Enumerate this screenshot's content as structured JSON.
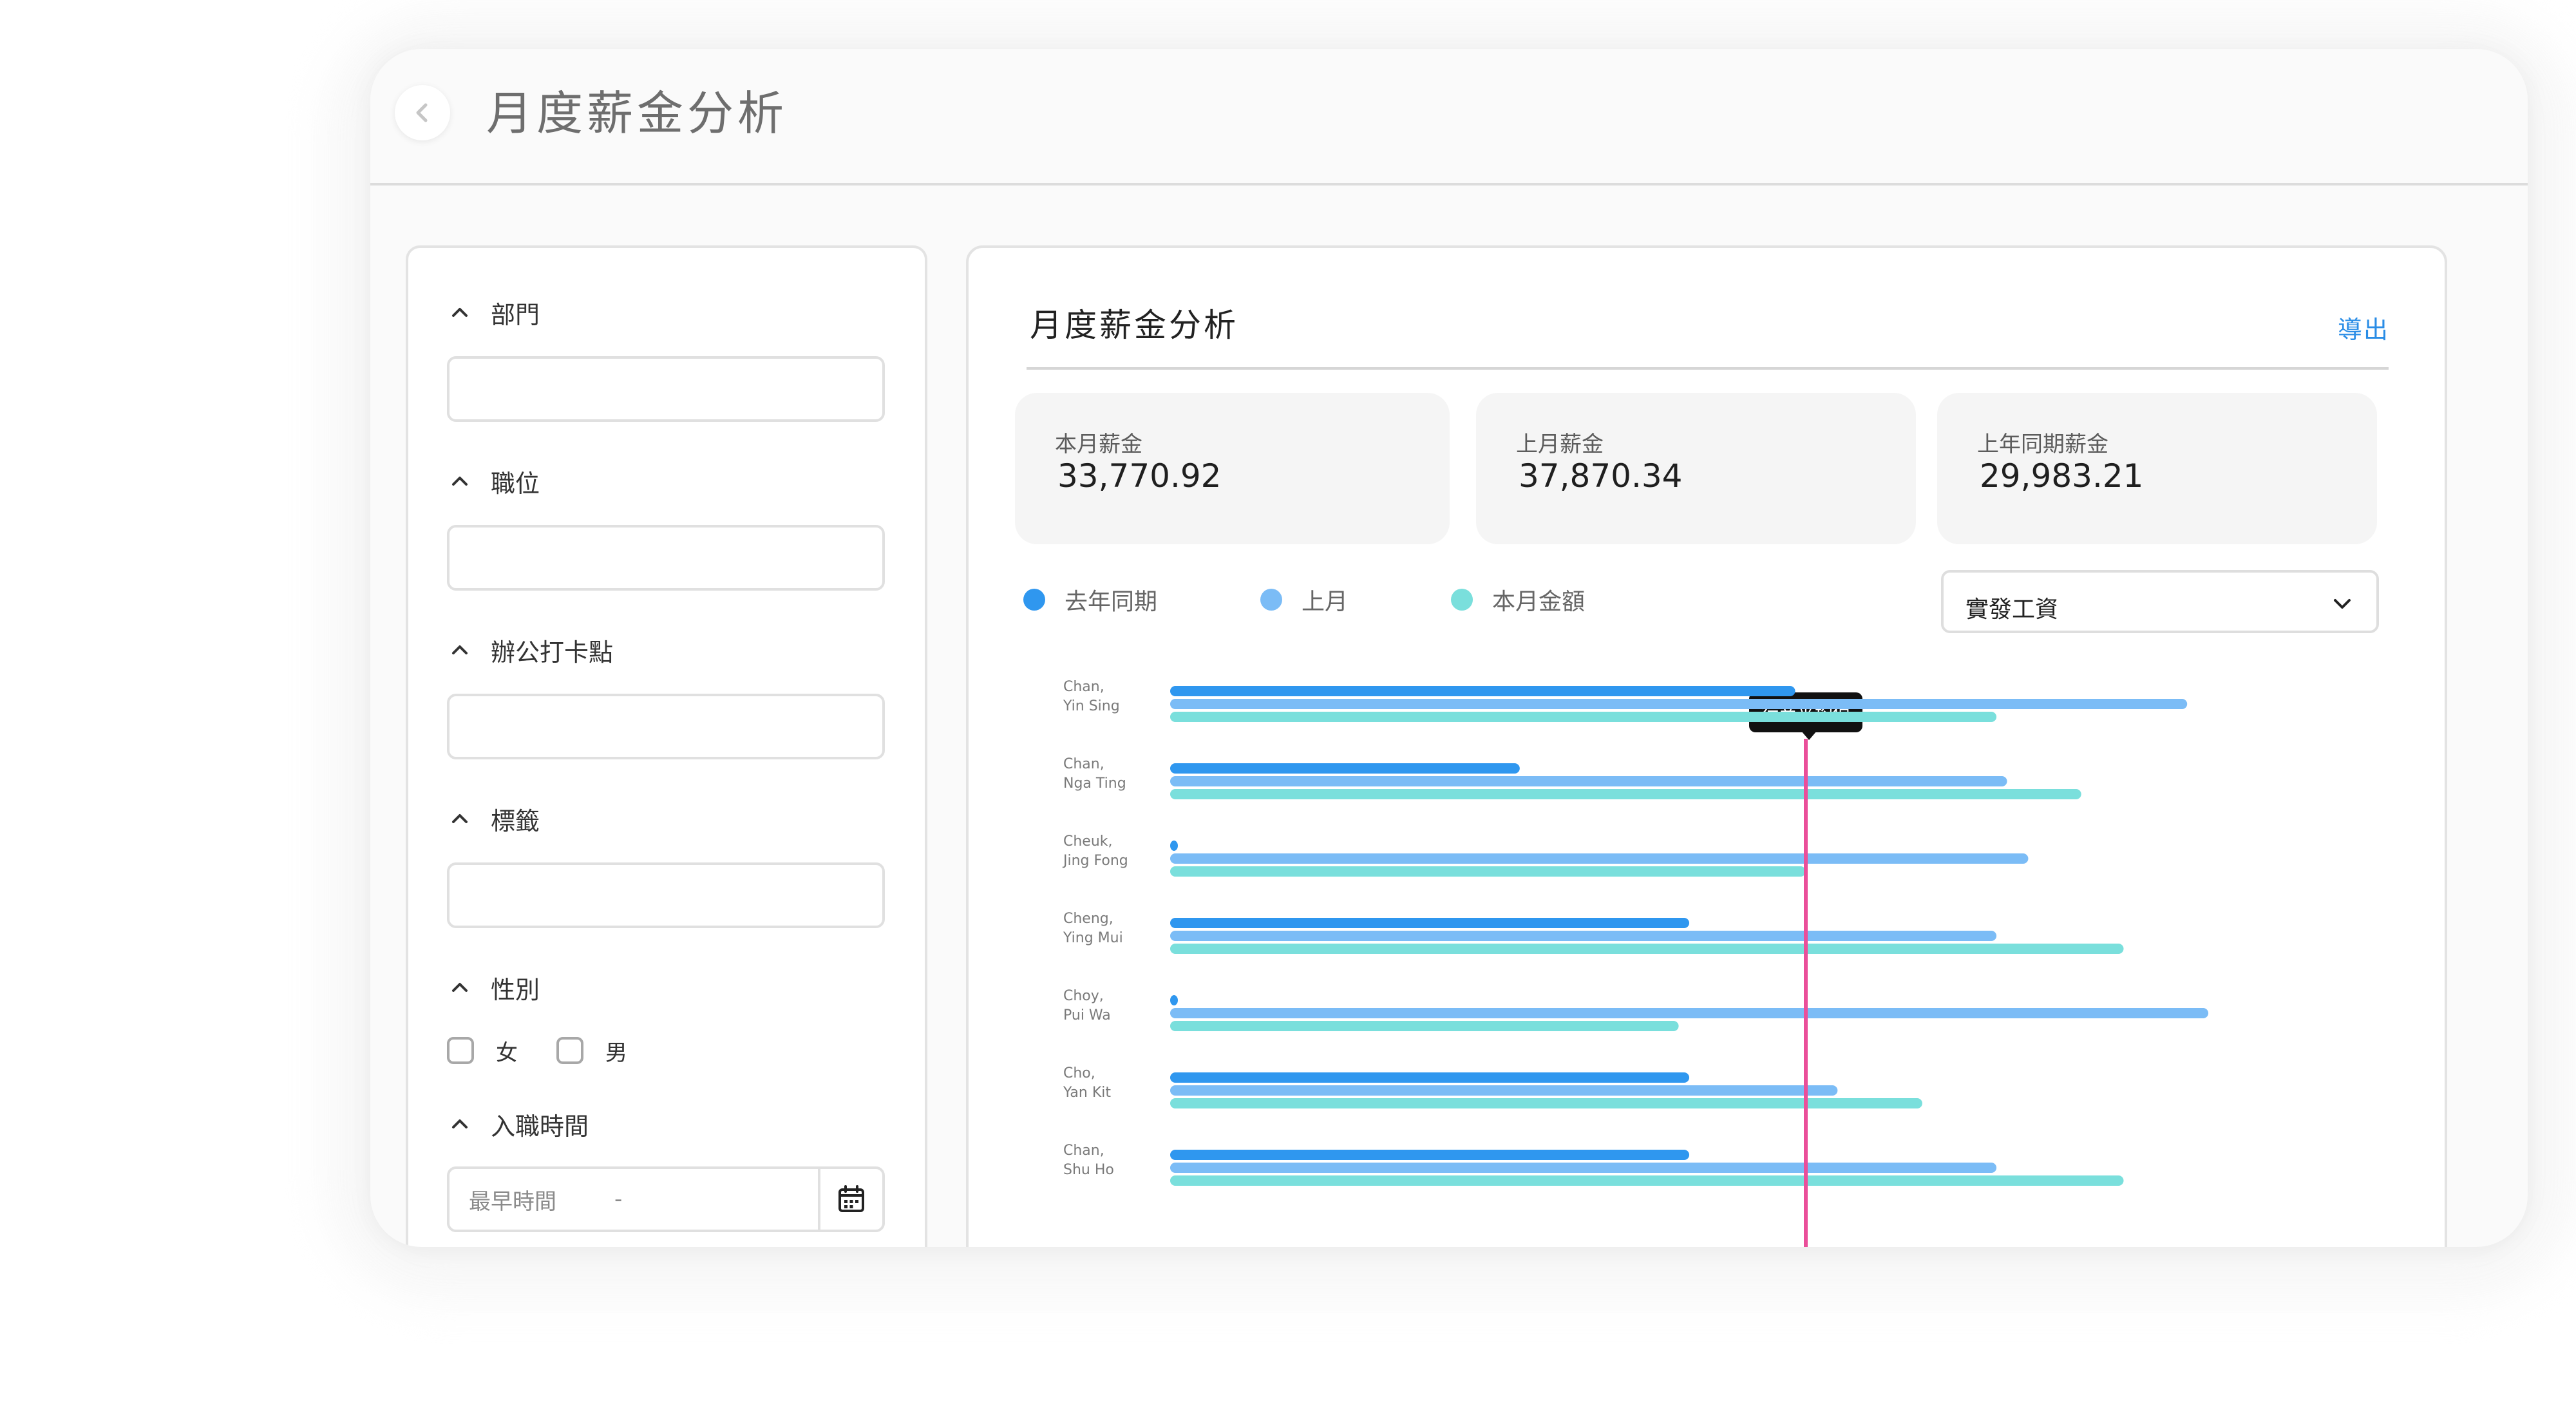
{
  "header": {
    "title": "月度薪金分析"
  },
  "filters": {
    "department": {
      "label": "部門"
    },
    "position": {
      "label": "職位"
    },
    "office": {
      "label": "辦公打卡點"
    },
    "tags": {
      "label": "標籤"
    },
    "gender": {
      "label": "性別",
      "options": [
        "女",
        "男"
      ]
    },
    "hire_date": {
      "label": "入職時間",
      "placeholder": "最早時間",
      "separator": "-"
    }
  },
  "panel": {
    "title": "月度薪金分析",
    "export_label": "導出",
    "stats": [
      {
        "label": "本月薪金",
        "value": "33,770.92"
      },
      {
        "label": "上月薪金",
        "value": "37,870.34"
      },
      {
        "label": "上年同期薪金",
        "value": "29,983.21"
      }
    ],
    "salary_select": {
      "value": "實發工資"
    },
    "tooltip": "行業平均值"
  },
  "colors": {
    "last_year": "#2f97ef",
    "last_month": "#7bbcf6",
    "this_month": "#7adfdc",
    "average_line": "#ea4f9a",
    "accent": "#2a8de6"
  },
  "chart_data": {
    "type": "bar",
    "orientation": "horizontal",
    "categories": [
      [
        "Chan,",
        "Yin Sing"
      ],
      [
        "Chan,",
        "Nga Ting"
      ],
      [
        "Cheuk,",
        "Jing Fong"
      ],
      [
        "Cheng,",
        "Ying Mui"
      ],
      [
        "Choy,",
        "Pui Wa"
      ],
      [
        "Cho,",
        "Yan Kit"
      ],
      [
        "Chan,",
        "Shu Ho"
      ]
    ],
    "series": [
      {
        "name": "去年同期",
        "values": [
          0.59,
          0.33,
          0.0,
          0.49,
          0.0,
          0.49,
          0.49
        ]
      },
      {
        "name": "上月",
        "values": [
          0.96,
          0.79,
          0.81,
          0.78,
          0.98,
          0.63,
          0.78
        ]
      },
      {
        "name": "本月金額",
        "values": [
          0.78,
          0.86,
          0.6,
          0.9,
          0.48,
          0.71,
          0.9
        ]
      }
    ],
    "reference_line": {
      "label": "行業平均值",
      "value": 0.6
    },
    "xlim": [
      0,
      1
    ],
    "grid": false,
    "legend": "top-left"
  }
}
